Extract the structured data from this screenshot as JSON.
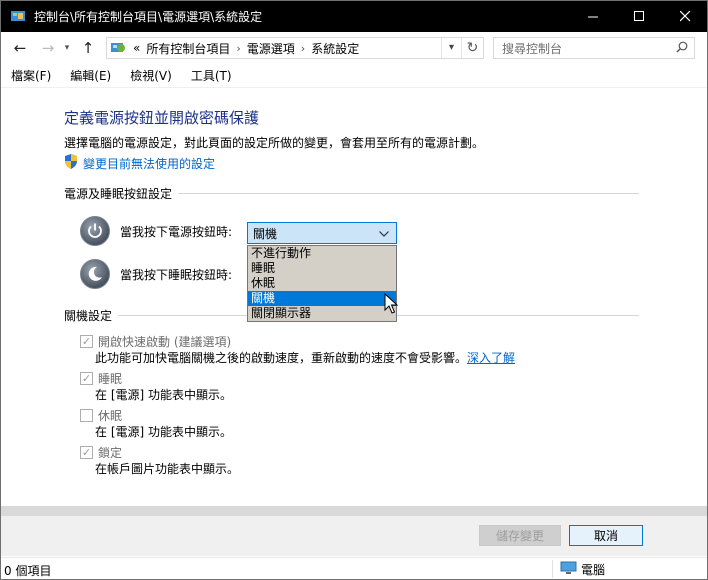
{
  "window": {
    "title": "控制台\\所有控制台項目\\電源選項\\系統設定",
    "minimize_icon": "minimize-icon",
    "maximize_icon": "maximize-icon",
    "close_icon": "close-icon"
  },
  "address": {
    "overflow": "«",
    "crumbs": [
      "所有控制台項目",
      "電源選項",
      "系統設定"
    ],
    "search_placeholder": "搜尋控制台"
  },
  "menu": [
    "檔案(F)",
    "編輯(E)",
    "檢視(V)",
    "工具(T)"
  ],
  "page": {
    "title": "定義電源按鈕並開啟密碼保護",
    "description": "選擇電腦的電源設定，對此頁面的設定所做的變更，會套用至所有的電源計劃。",
    "admin_link": "變更目前無法使用的設定"
  },
  "power_section": {
    "header": "電源及睡眠按鈕設定",
    "power_button_label": "當我按下電源按鈕時:",
    "sleep_button_label": "當我按下睡眠按鈕時:",
    "power_button_value": "關機",
    "dropdown_options": [
      "不進行動作",
      "睡眠",
      "休眠",
      "關機",
      "關閉顯示器"
    ],
    "dropdown_selected_index": 3
  },
  "shutdown_section": {
    "header": "關機設定",
    "fast_startup": {
      "label": "開啟快速啟動 (建議選項)",
      "checked": true,
      "desc": "此功能可加快電腦關機之後的啟動速度，重新啟動的速度不會受影響。",
      "link": "深入了解"
    },
    "sleep": {
      "label": "睡眠",
      "checked": true,
      "desc": "在 [電源] 功能表中顯示。"
    },
    "hibernate": {
      "label": "休眠",
      "checked": false,
      "desc": "在 [電源] 功能表中顯示。"
    },
    "lock": {
      "label": "鎖定",
      "checked": true,
      "desc": "在帳戶圖片功能表中顯示。"
    }
  },
  "buttons": {
    "save": "儲存變更",
    "cancel": "取消"
  },
  "status": {
    "items": "0 個項目",
    "location": "電腦"
  },
  "colors": {
    "accent": "#0078d7",
    "title_blue": "#1e3287",
    "link": "#0066cc"
  }
}
